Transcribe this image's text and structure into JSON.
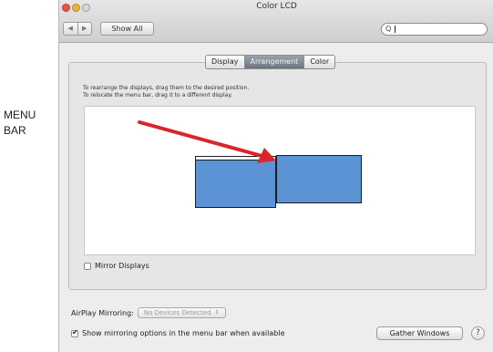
{
  "side_label": [
    "MENU",
    "BAR"
  ],
  "window": {
    "title": "Color LCD",
    "nav_back": "◀",
    "nav_forward": "▶",
    "show_all": "Show All",
    "search_icon_glyph": "Q"
  },
  "tabs": [
    {
      "label": "Display",
      "active": false
    },
    {
      "label": "Arrangement",
      "active": true
    },
    {
      "label": "Color",
      "active": false
    }
  ],
  "instructions": [
    "To rearrange the displays, drag them to the desired position.",
    "To relocate the menu bar, drag it to a different display."
  ],
  "mirror_displays": {
    "label": "Mirror Displays",
    "checked": false
  },
  "airplay": {
    "label": "AirPlay Mirroring:",
    "value": "No Devices Detected",
    "arrows": "⇕"
  },
  "show_mirroring": {
    "label": "Show mirroring options in the menu bar when available",
    "checked": true
  },
  "buttons": {
    "gather_windows": "Gather Windows",
    "help": "?"
  },
  "colors": {
    "display_fill": "#5b93d4",
    "arrow": "#d8262a"
  }
}
